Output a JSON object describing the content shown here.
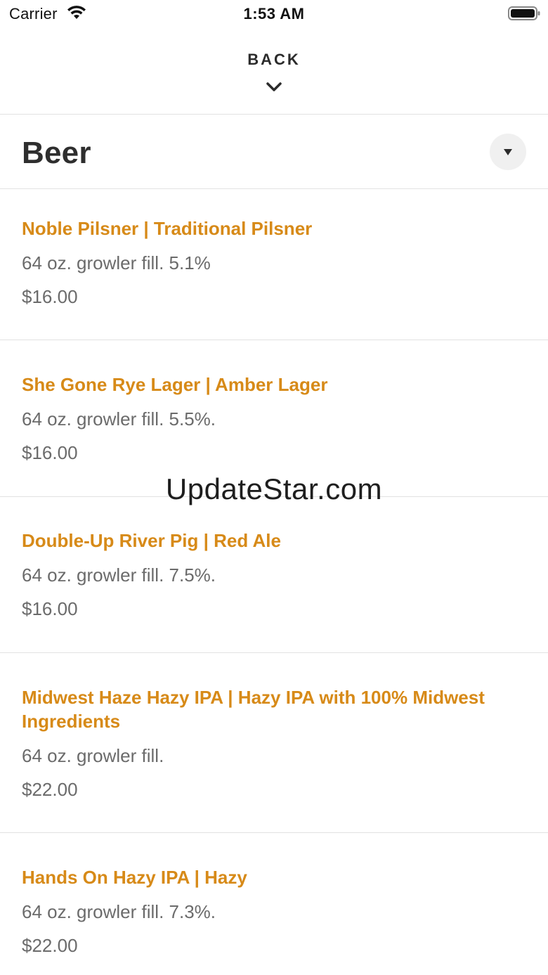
{
  "status_bar": {
    "carrier": "Carrier",
    "time": "1:53 AM"
  },
  "header": {
    "back_label": "BACK"
  },
  "section": {
    "title": "Beer"
  },
  "items": [
    {
      "name": "Noble Pilsner | Traditional Pilsner",
      "description": "64 oz. growler fill. 5.1%",
      "price": "$16.00"
    },
    {
      "name": "She Gone Rye Lager | Amber Lager",
      "description": "64 oz. growler fill. 5.5%.",
      "price": "$16.00"
    },
    {
      "name": "Double-Up River Pig | Red Ale",
      "description": "64 oz. growler fill. 7.5%.",
      "price": "$16.00"
    },
    {
      "name": "Midwest Haze Hazy IPA | Hazy IPA with 100% Midwest Ingredients",
      "description": "64 oz. growler fill.",
      "price": "$22.00"
    },
    {
      "name": "Hands On Hazy IPA | Hazy",
      "description": "64 oz. growler fill. 7.3%.",
      "price": "$22.00"
    }
  ],
  "watermark": "UpdateStar.com",
  "colors": {
    "item_name": "#d78a18",
    "item_text": "#6b6b6b",
    "divider": "#e2e2e2"
  }
}
